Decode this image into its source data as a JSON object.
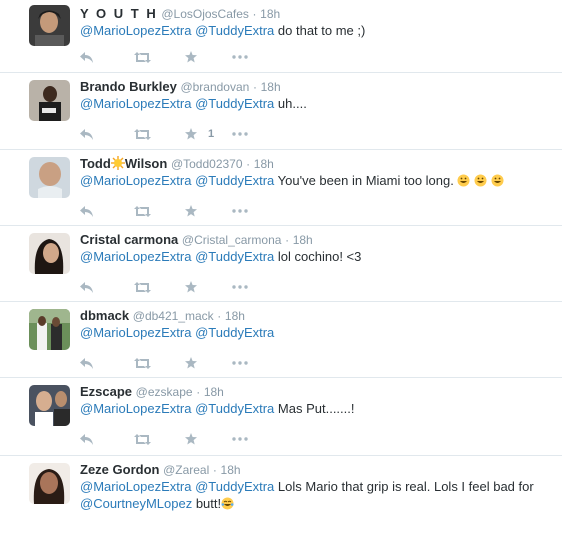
{
  "colors": {
    "link": "#2b7bb9",
    "meta": "#8899a6",
    "icon": "#aab8c2",
    "divider": "#e1e8ed"
  },
  "icons": {
    "reply": "reply-icon",
    "retweet": "retweet-icon",
    "favorite": "star-icon",
    "more": "more-dots-icon"
  },
  "tweets": [
    {
      "name": "Y O U T H",
      "handle": "@LosOjosCafes",
      "dot": "·",
      "time": "18h",
      "m1": "@MarioLopezExtra",
      "m2": "@TuddyExtra",
      "text": "do that to me ;)",
      "fav_count": ""
    },
    {
      "name": "Brando Burkley",
      "handle": "@brandovan",
      "dot": "·",
      "time": "18h",
      "m1": "@MarioLopezExtra",
      "m2": "@TuddyExtra",
      "text": "uh....",
      "fav_count": "1"
    },
    {
      "name_a": "Todd",
      "name_b": "Wilson",
      "handle": "@Todd02370",
      "dot": "·",
      "time": "18h",
      "m1": "@MarioLopezExtra",
      "m2": "@TuddyExtra",
      "text": "You've been in Miami too long.",
      "fav_count": ""
    },
    {
      "name": "Cristal carmona",
      "handle": "@Cristal_carmona",
      "dot": "·",
      "time": "18h",
      "m1": "@MarioLopezExtra",
      "m2": "@TuddyExtra",
      "text": "lol cochino! <3",
      "fav_count": ""
    },
    {
      "name": "dbmack",
      "handle": "@db421_mack",
      "dot": "·",
      "time": "18h",
      "m1": "@MarioLopezExtra",
      "m2": "@TuddyExtra",
      "text": "",
      "fav_count": ""
    },
    {
      "name": "Ezscape",
      "handle": "@ezskape",
      "dot": "·",
      "time": "18h",
      "m1": "@MarioLopezExtra",
      "m2": "@TuddyExtra",
      "text": "Mas Put.......!",
      "fav_count": ""
    },
    {
      "name": "Zeze Gordon",
      "handle": "@Zareal",
      "dot": "·",
      "time": "18h",
      "m1": "@MarioLopezExtra",
      "m2": "@TuddyExtra",
      "text": "Lols Mario that grip is real. Lols I feel bad for",
      "m3": "@CourtneyMLopez",
      "text2": "butt!",
      "fav_count": ""
    }
  ]
}
